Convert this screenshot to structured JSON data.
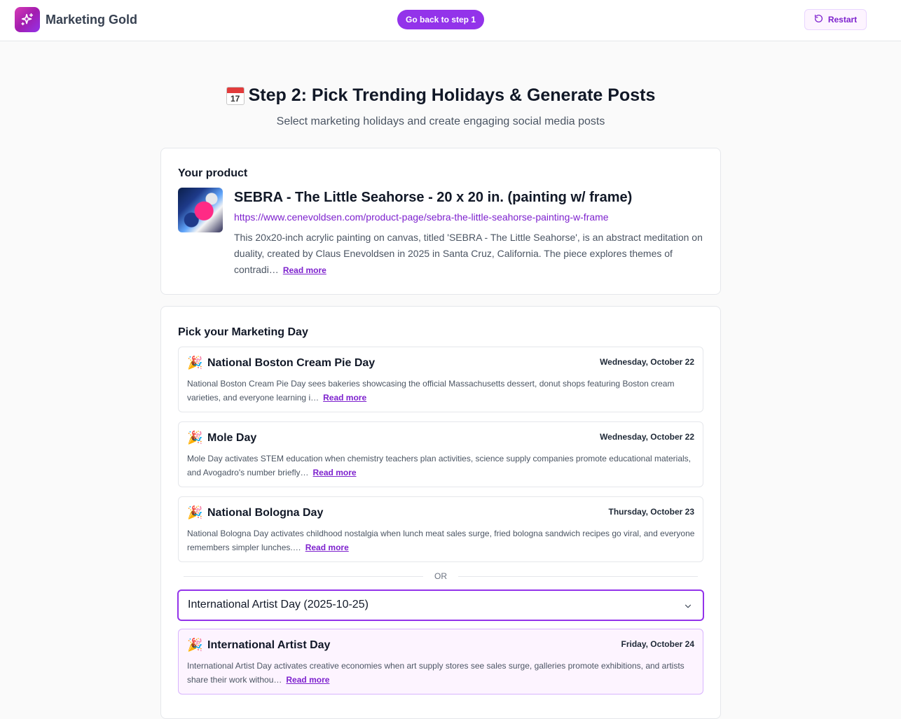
{
  "header": {
    "brand_name": "Marketing Gold",
    "back_button": "Go back to step 1",
    "restart_button": "Restart"
  },
  "page": {
    "title": "Step 2: Pick Trending Holidays & Generate Posts",
    "calendar_day": "17",
    "subtitle": "Select marketing holidays and create engaging social media posts"
  },
  "product": {
    "heading": "Your product",
    "title": "SEBRA - The Little Seahorse - 20 x 20 in. (painting w/ frame)",
    "url": "https://www.cenevoldsen.com/product-page/sebra-the-little-seahorse-painting-w-frame",
    "description": "This 20x20-inch acrylic painting on canvas, titled 'SEBRA - The Little Seahorse', is an abstract meditation on duality, created by Claus Enevoldsen in 2025 in Santa Cruz, California. The piece explores themes of contradi…",
    "read_more": "Read more"
  },
  "holidays": {
    "heading": "Pick your Marketing Day",
    "items": [
      {
        "icon": "party-popper-icon",
        "name": "National Boston Cream Pie Day",
        "date": "Wednesday, October 22",
        "description": "National Boston Cream Pie Day sees bakeries showcasing the official Massachusetts dessert, donut shops featuring Boston cream varieties, and everyone learning i…",
        "read_more": "Read more"
      },
      {
        "icon": "party-popper-icon",
        "name": "Mole Day",
        "date": "Wednesday, October 22",
        "description": "Mole Day activates STEM education when chemistry teachers plan activities, science supply companies promote educational materials, and Avogadro's number briefly…",
        "read_more": "Read more"
      },
      {
        "icon": "party-popper-icon",
        "name": "National Bologna Day",
        "date": "Thursday, October 23",
        "description": "National Bologna Day activates childhood nostalgia when lunch meat sales surge, fried bologna sandwich recipes go viral, and everyone remembers simpler lunches.…",
        "read_more": "Read more"
      }
    ],
    "or_label": "OR",
    "select_value": "International Artist Day (2025-10-25)",
    "selected": {
      "icon": "party-popper-icon",
      "name": "International Artist Day",
      "date": "Friday, October 24",
      "description": "International Artist Day activates creative economies when art supply stores see sales surge, galleries promote exhibitions, and artists share their work withou…",
      "read_more": "Read more"
    }
  },
  "colors": {
    "accent": "#9333ea",
    "link": "#7e22ce",
    "selected_bg": "#fdf4ff"
  }
}
